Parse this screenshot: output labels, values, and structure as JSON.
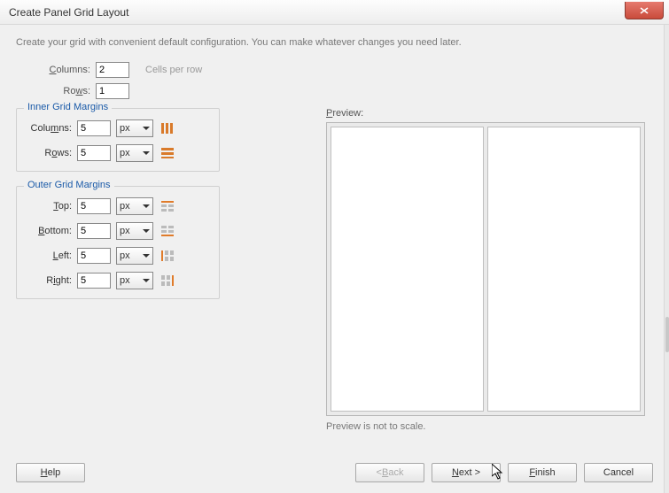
{
  "window": {
    "title": "Create Panel Grid Layout"
  },
  "instruction": "Create your grid with convenient default configuration. You can make whatever changes you need later.",
  "grid": {
    "columns_label": "Columns:",
    "columns_value": "2",
    "columns_hint": "Cells per row",
    "rows_label": "Rows:",
    "rows_value": "1"
  },
  "inner": {
    "legend": "Inner Grid Margins",
    "columns_label": "Columns:",
    "columns_value": "5",
    "columns_unit": "px",
    "rows_label": "Rows:",
    "rows_value": "5",
    "rows_unit": "px"
  },
  "outer": {
    "legend": "Outer Grid Margins",
    "top_label": "Top:",
    "top_value": "5",
    "top_unit": "px",
    "bottom_label": "Bottom:",
    "bottom_value": "5",
    "bottom_unit": "px",
    "left_label": "Left:",
    "left_value": "5",
    "left_unit": "px",
    "right_label": "Right:",
    "right_value": "5",
    "right_unit": "px"
  },
  "preview": {
    "label": "Preview:",
    "note": "Preview is not to scale."
  },
  "buttons": {
    "help": "Help",
    "back": "< Back",
    "next": "Next >",
    "finish": "Finish",
    "cancel": "Cancel"
  }
}
